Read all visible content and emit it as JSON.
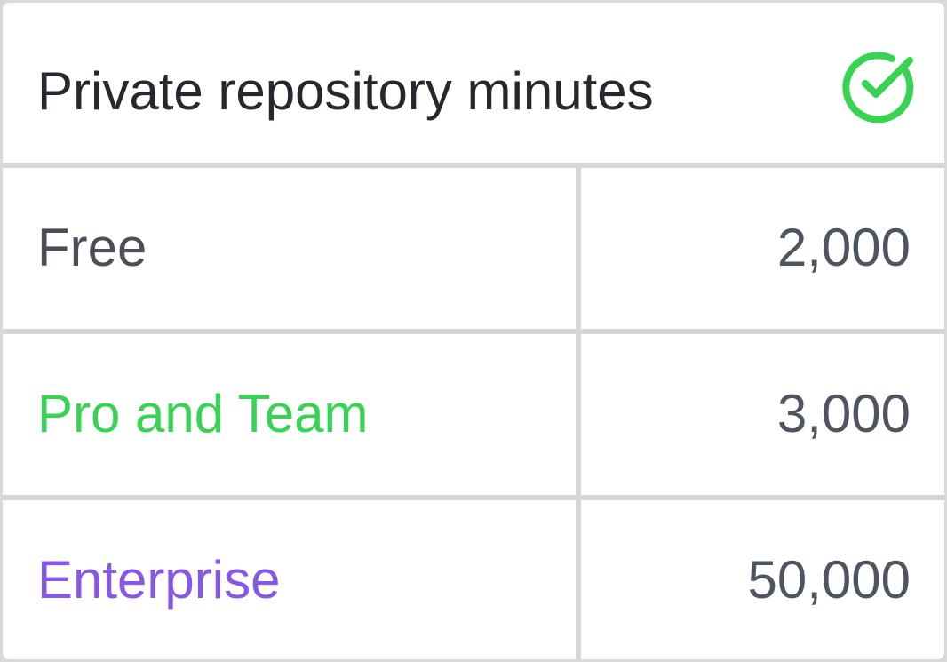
{
  "header": {
    "title": "Private repository minutes",
    "icon": "check-circle-icon",
    "icon_color": "#39d353"
  },
  "rows": [
    {
      "plan": "Free",
      "minutes": "2,000",
      "plan_color": "#4a4f57"
    },
    {
      "plan": "Pro and Team",
      "minutes": "3,000",
      "plan_color": "#39d353"
    },
    {
      "plan": "Enterprise",
      "minutes": "50,000",
      "plan_color": "#8957e5"
    }
  ]
}
